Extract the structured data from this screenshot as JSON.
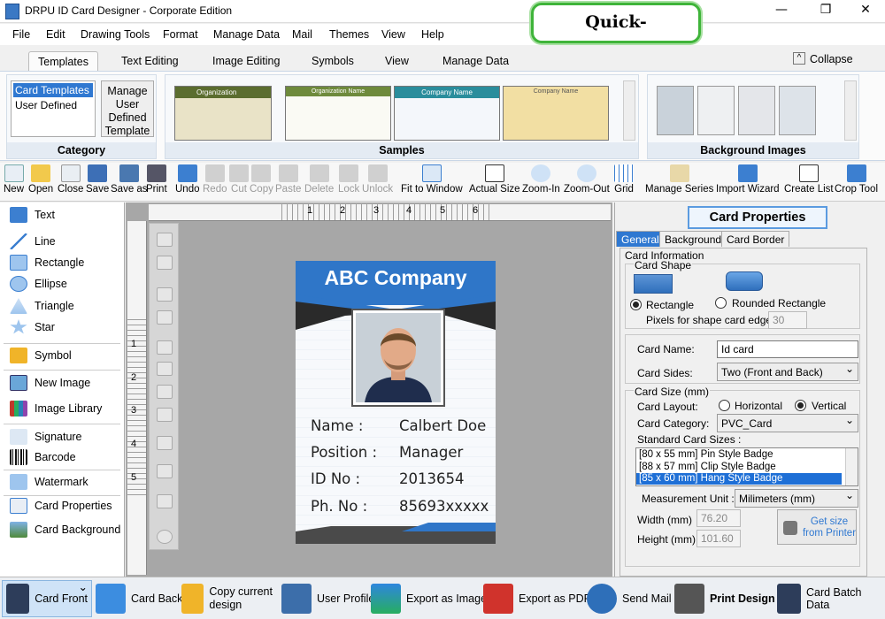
{
  "window": {
    "title": "DRPU ID Card Designer - Corporate Edition",
    "minimize": "—",
    "restore": "❐",
    "close": "✕"
  },
  "brand": {
    "badge": "Quick-Billing.com"
  },
  "menu": [
    "File",
    "Edit",
    "Drawing Tools",
    "Format",
    "Manage Data",
    "Mail",
    "Themes",
    "View",
    "Help"
  ],
  "ribbon_tabs": [
    "Templates",
    "Text Editing",
    "Image Editing",
    "Symbols",
    "View",
    "Manage Data"
  ],
  "collapse_label": "Collapse",
  "category": {
    "items": [
      "Card Templates",
      "User Defined"
    ],
    "manage_button": "Manage User Defined Template",
    "label": "Category"
  },
  "samples": {
    "label": "Samples",
    "thumbs": [
      "Organization",
      "Organization Name",
      "Company Name",
      "Company Name"
    ]
  },
  "background_images": {
    "label": "Background Images"
  },
  "toolbar": [
    "New",
    "Open",
    "Close",
    "Save",
    "Save as",
    "Print",
    "Undo",
    "Redo",
    "Cut",
    "Copy",
    "Paste",
    "Delete",
    "Lock",
    "Unlock",
    "Fit to Window",
    "Actual Size",
    "Zoom-In",
    "Zoom-Out",
    "Grid",
    "Manage Series",
    "Import Wizard",
    "Create List",
    "Crop Tool"
  ],
  "left_panel": [
    "Text",
    "Line",
    "Rectangle",
    "Ellipse",
    "Triangle",
    "Star",
    "Symbol",
    "New Image",
    "Image Library",
    "Signature",
    "Barcode",
    "Watermark",
    "Card Properties",
    "Card Background"
  ],
  "ruler": {
    "h": [
      "1",
      "2",
      "3",
      "4",
      "5",
      "6"
    ],
    "v": [
      "1",
      "2",
      "3",
      "4",
      "5"
    ]
  },
  "card": {
    "company": "ABC Company",
    "fields": [
      {
        "k": "Name :",
        "v": "Calbert Doe"
      },
      {
        "k": "Position :",
        "v": "Manager"
      },
      {
        "k": "ID No :",
        "v": "2013654"
      },
      {
        "k": "Ph. No :",
        "v": "85693xxxxx"
      }
    ]
  },
  "props": {
    "title": "Card Properties",
    "tabs": [
      "General",
      "Background",
      "Card Border"
    ],
    "card_information": "Card Information",
    "card_shape": "Card Shape",
    "rect_label": "Rectangle",
    "rounded_label": "Rounded Rectangle",
    "pixels_label": "Pixels for shape card edge :",
    "pixels_value": "30",
    "card_name_label": "Card Name:",
    "card_name_value": "Id card",
    "card_sides_label": "Card Sides:",
    "card_sides_value": "Two (Front and Back)",
    "card_size_label": "Card Size (mm)",
    "layout_label": "Card Layout:",
    "horizontal": "Horizontal",
    "vertical": "Vertical",
    "category_label": "Card Category:",
    "category_value": "PVC_Card",
    "std_sizes_label": "Standard Card Sizes :",
    "std_sizes": [
      "[80 x 55 mm] Pin Style Badge",
      "[88 x 57 mm] Clip Style Badge",
      "[85 x 60 mm] Hang Style Badge"
    ],
    "measure_label": "Measurement Unit :",
    "measure_value": "Milimeters (mm)",
    "width_label": "Width  (mm)",
    "width_value": "76.20",
    "height_label": "Height  (mm)",
    "height_value": "101.60",
    "get_size": "Get size from Printer"
  },
  "bottom": [
    "Card Front",
    "Card Back",
    "Copy current design",
    "User Profile",
    "Export as Image",
    "Export as PDF",
    "Send Mail",
    "Print Design",
    "Card Batch Data"
  ]
}
